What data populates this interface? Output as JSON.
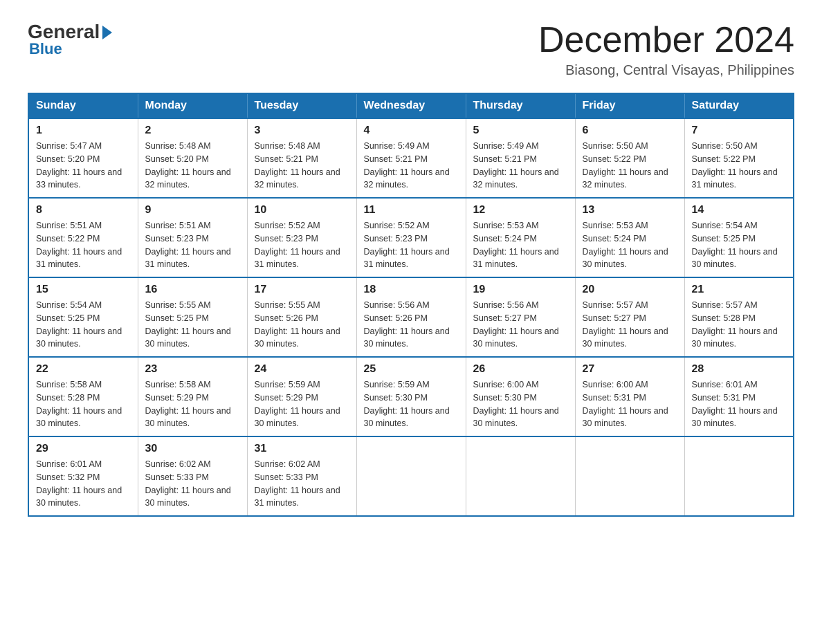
{
  "logo": {
    "general": "General",
    "blue": "Blue"
  },
  "title": "December 2024",
  "location": "Biasong, Central Visayas, Philippines",
  "weekdays": [
    "Sunday",
    "Monday",
    "Tuesday",
    "Wednesday",
    "Thursday",
    "Friday",
    "Saturday"
  ],
  "weeks": [
    [
      {
        "day": "1",
        "sunrise": "5:47 AM",
        "sunset": "5:20 PM",
        "daylight": "11 hours and 33 minutes."
      },
      {
        "day": "2",
        "sunrise": "5:48 AM",
        "sunset": "5:20 PM",
        "daylight": "11 hours and 32 minutes."
      },
      {
        "day": "3",
        "sunrise": "5:48 AM",
        "sunset": "5:21 PM",
        "daylight": "11 hours and 32 minutes."
      },
      {
        "day": "4",
        "sunrise": "5:49 AM",
        "sunset": "5:21 PM",
        "daylight": "11 hours and 32 minutes."
      },
      {
        "day": "5",
        "sunrise": "5:49 AM",
        "sunset": "5:21 PM",
        "daylight": "11 hours and 32 minutes."
      },
      {
        "day": "6",
        "sunrise": "5:50 AM",
        "sunset": "5:22 PM",
        "daylight": "11 hours and 32 minutes."
      },
      {
        "day": "7",
        "sunrise": "5:50 AM",
        "sunset": "5:22 PM",
        "daylight": "11 hours and 31 minutes."
      }
    ],
    [
      {
        "day": "8",
        "sunrise": "5:51 AM",
        "sunset": "5:22 PM",
        "daylight": "11 hours and 31 minutes."
      },
      {
        "day": "9",
        "sunrise": "5:51 AM",
        "sunset": "5:23 PM",
        "daylight": "11 hours and 31 minutes."
      },
      {
        "day": "10",
        "sunrise": "5:52 AM",
        "sunset": "5:23 PM",
        "daylight": "11 hours and 31 minutes."
      },
      {
        "day": "11",
        "sunrise": "5:52 AM",
        "sunset": "5:23 PM",
        "daylight": "11 hours and 31 minutes."
      },
      {
        "day": "12",
        "sunrise": "5:53 AM",
        "sunset": "5:24 PM",
        "daylight": "11 hours and 31 minutes."
      },
      {
        "day": "13",
        "sunrise": "5:53 AM",
        "sunset": "5:24 PM",
        "daylight": "11 hours and 30 minutes."
      },
      {
        "day": "14",
        "sunrise": "5:54 AM",
        "sunset": "5:25 PM",
        "daylight": "11 hours and 30 minutes."
      }
    ],
    [
      {
        "day": "15",
        "sunrise": "5:54 AM",
        "sunset": "5:25 PM",
        "daylight": "11 hours and 30 minutes."
      },
      {
        "day": "16",
        "sunrise": "5:55 AM",
        "sunset": "5:25 PM",
        "daylight": "11 hours and 30 minutes."
      },
      {
        "day": "17",
        "sunrise": "5:55 AM",
        "sunset": "5:26 PM",
        "daylight": "11 hours and 30 minutes."
      },
      {
        "day": "18",
        "sunrise": "5:56 AM",
        "sunset": "5:26 PM",
        "daylight": "11 hours and 30 minutes."
      },
      {
        "day": "19",
        "sunrise": "5:56 AM",
        "sunset": "5:27 PM",
        "daylight": "11 hours and 30 minutes."
      },
      {
        "day": "20",
        "sunrise": "5:57 AM",
        "sunset": "5:27 PM",
        "daylight": "11 hours and 30 minutes."
      },
      {
        "day": "21",
        "sunrise": "5:57 AM",
        "sunset": "5:28 PM",
        "daylight": "11 hours and 30 minutes."
      }
    ],
    [
      {
        "day": "22",
        "sunrise": "5:58 AM",
        "sunset": "5:28 PM",
        "daylight": "11 hours and 30 minutes."
      },
      {
        "day": "23",
        "sunrise": "5:58 AM",
        "sunset": "5:29 PM",
        "daylight": "11 hours and 30 minutes."
      },
      {
        "day": "24",
        "sunrise": "5:59 AM",
        "sunset": "5:29 PM",
        "daylight": "11 hours and 30 minutes."
      },
      {
        "day": "25",
        "sunrise": "5:59 AM",
        "sunset": "5:30 PM",
        "daylight": "11 hours and 30 minutes."
      },
      {
        "day": "26",
        "sunrise": "6:00 AM",
        "sunset": "5:30 PM",
        "daylight": "11 hours and 30 minutes."
      },
      {
        "day": "27",
        "sunrise": "6:00 AM",
        "sunset": "5:31 PM",
        "daylight": "11 hours and 30 minutes."
      },
      {
        "day": "28",
        "sunrise": "6:01 AM",
        "sunset": "5:31 PM",
        "daylight": "11 hours and 30 minutes."
      }
    ],
    [
      {
        "day": "29",
        "sunrise": "6:01 AM",
        "sunset": "5:32 PM",
        "daylight": "11 hours and 30 minutes."
      },
      {
        "day": "30",
        "sunrise": "6:02 AM",
        "sunset": "5:33 PM",
        "daylight": "11 hours and 30 minutes."
      },
      {
        "day": "31",
        "sunrise": "6:02 AM",
        "sunset": "5:33 PM",
        "daylight": "11 hours and 31 minutes."
      },
      null,
      null,
      null,
      null
    ]
  ]
}
